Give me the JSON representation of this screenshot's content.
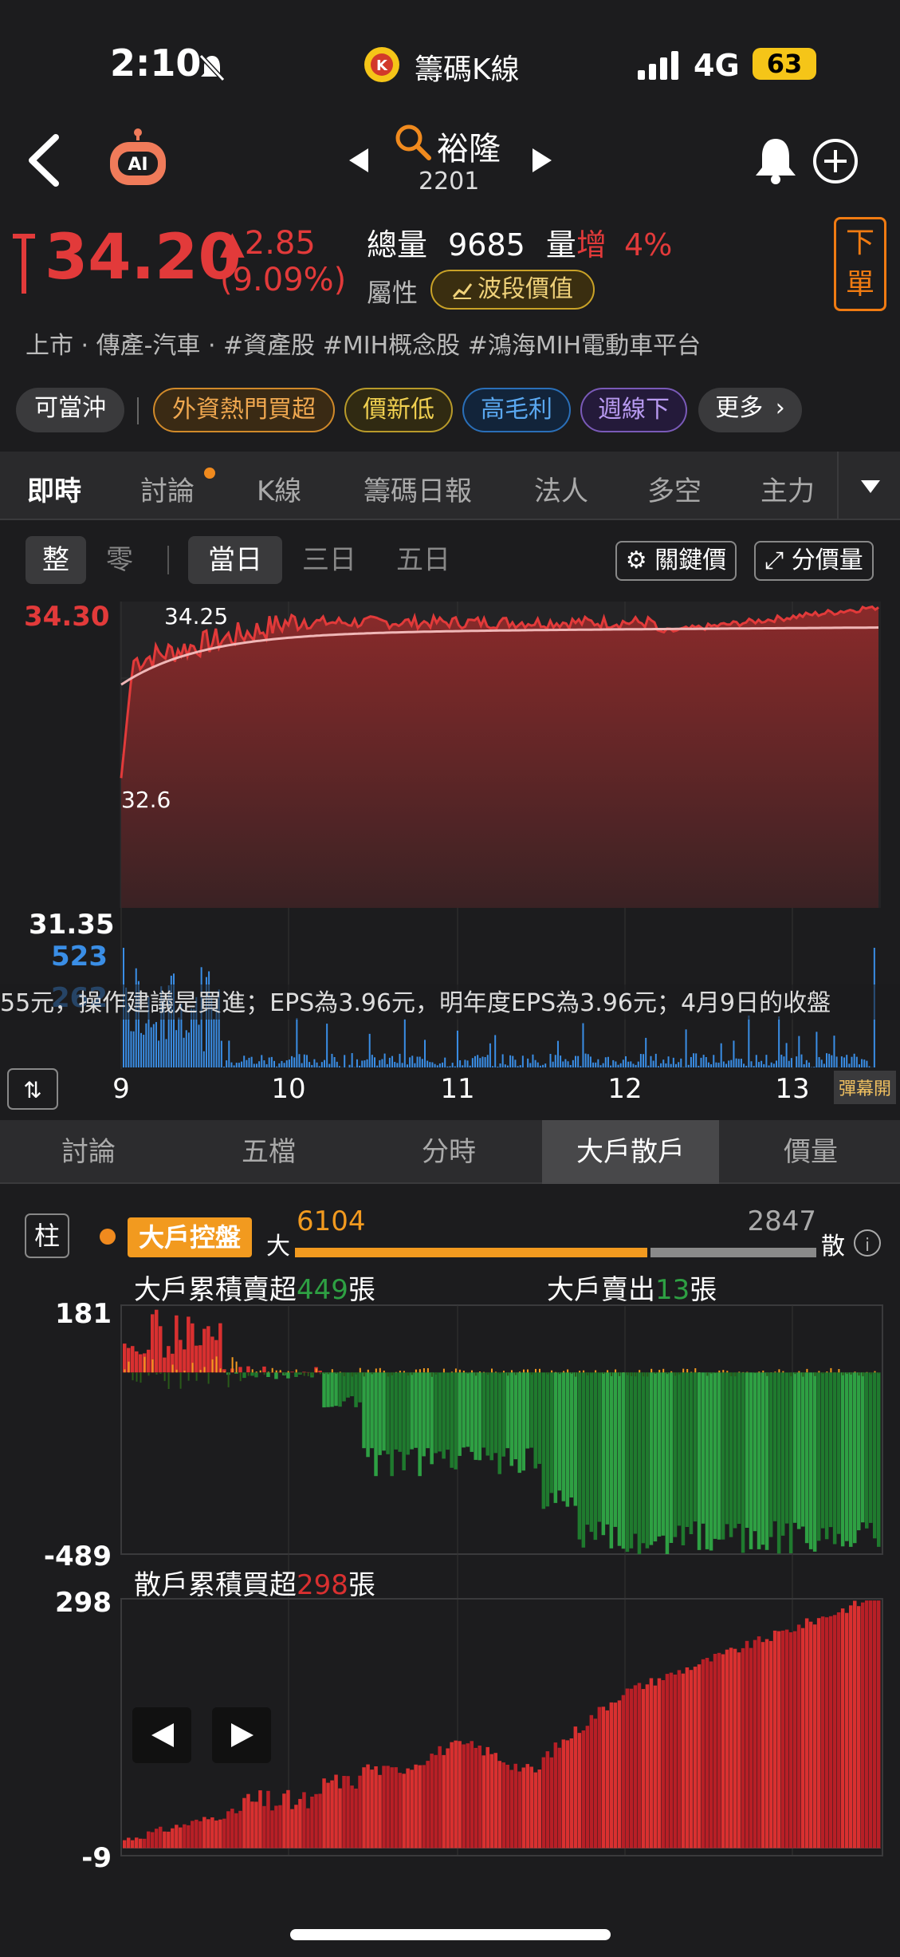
{
  "status": {
    "time": "2:10",
    "app_title": "籌碼K線",
    "network": "4G",
    "battery": "63"
  },
  "stock": {
    "name": "裕隆",
    "code": "2201",
    "price": "34.20",
    "change": "▲2.85",
    "change_pct": "(9.09%)"
  },
  "volume": {
    "label": "總量",
    "value": "9685",
    "vol_label": "量",
    "increase": "增",
    "increase_pct": "4%"
  },
  "attribute": {
    "label": "屬性",
    "pill": "波段價值"
  },
  "order_button": "下單",
  "tags_line": "上市 · 傳產-汽車 · #資產股 #MIH概念股 #鴻海MIH電動車平台",
  "chips": [
    "可當沖",
    "外資熱門買超",
    "價新低",
    "高毛利",
    "週線下",
    "更多"
  ],
  "tabs": [
    "即時",
    "討論",
    "K線",
    "籌碼日報",
    "法人",
    "多空",
    "主力"
  ],
  "sub": {
    "whole": "整",
    "odd": "零",
    "range": [
      "當日",
      "三日",
      "五日"
    ],
    "key_price": "關鍵價",
    "split_volume": "分價量"
  },
  "intraday": {
    "price_high": "34.30",
    "price_low": "31.35",
    "mark_high": "34.25",
    "mark_low": "32.6",
    "vol_max": "523",
    "vol_mid": "262",
    "ticker": "55元，操作建議是買進；EPS為3.96元，明年度EPS為3.96元；4月9日的收盤",
    "x_labels": [
      "9",
      "10",
      "11",
      "12",
      "13"
    ],
    "danmaku": "彈幕開",
    "colors": {
      "price_line": "#e23a3a",
      "avg_line": "#f0b7b7",
      "volume": "#3a8ee6"
    }
  },
  "panel_tabs": [
    "討論",
    "五檔",
    "分時",
    "大戶散戶",
    "價量"
  ],
  "bigsmall": {
    "pillar": "柱",
    "control": "大戶控盤",
    "big_label": "大",
    "big_value": "6104",
    "small_value": "2847",
    "small_label": "散",
    "big_title_prefix": "大戶累積賣超",
    "big_title_value": "449",
    "big_title_unit": "張",
    "big_sell_prefix": "大戶賣出",
    "big_sell_value": "13",
    "big_sell_unit": "張",
    "big_ymax": "181",
    "big_ymin": "-489",
    "small_title_prefix": "散戶累積買超",
    "small_title_value": "298",
    "small_title_unit": "張",
    "small_ymax": "298",
    "small_ymin": "-9",
    "colors": {
      "big_bar": "#f29a1f",
      "small_bar": "#8a8a8a",
      "green": "#2ea043",
      "red": "#d93030"
    }
  }
}
